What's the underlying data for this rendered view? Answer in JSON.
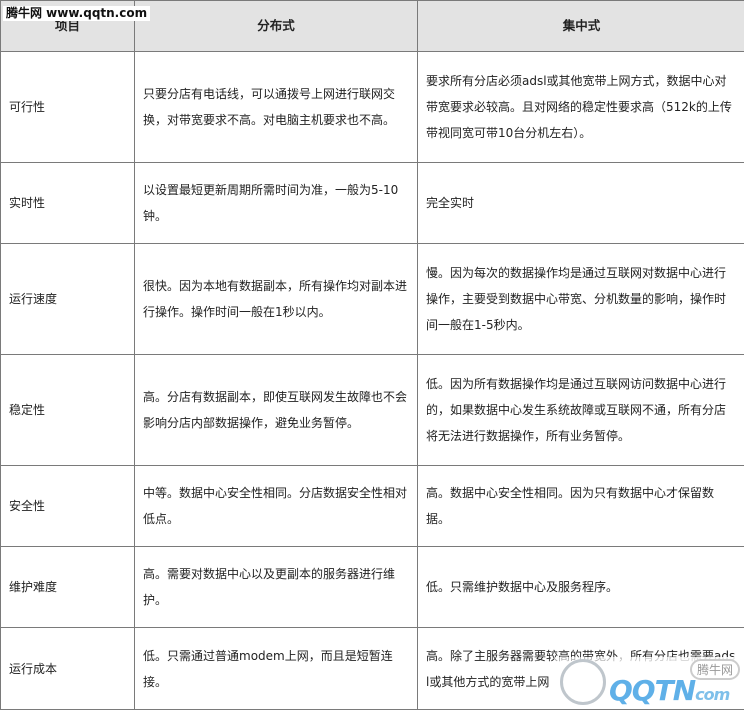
{
  "watermark": {
    "top": "腾牛网 www.qqtn.com",
    "logo_text": "QQTN",
    "logo_suffix": "com",
    "badge": "腾牛网"
  },
  "headers": [
    "项目",
    "分布式",
    "集中式"
  ],
  "rows": [
    {
      "item": "可行性",
      "distributed": "只要分店有电话线，可以通拨号上网进行联网交换，对带宽要求不高。对电脑主机要求也不高。",
      "centralized": "要求所有分店必须adsl或其他宽带上网方式，数据中心对带宽要求必较高。且对网络的稳定性要求高（512k的上传带视同宽可带10台分机左右）。"
    },
    {
      "item": "实时性",
      "distributed": "以设置最短更新周期所需时间为准，一般为5-10钟。",
      "centralized": "完全实时"
    },
    {
      "item": "运行速度",
      "distributed": "很快。因为本地有数据副本，所有操作均对副本进行操作。操作时间一般在1秒以内。",
      "centralized": "慢。因为每次的数据操作均是通过互联网对数据中心进行操作，主要受到数据中心带宽、分机数量的影响，操作时间一般在1-5秒内。"
    },
    {
      "item": "稳定性",
      "distributed": "高。分店有数据副本，即使互联网发生故障也不会影响分店内部数据操作，避免业务暂停。",
      "centralized": "低。因为所有数据操作均是通过互联网访问数据中心进行的，如果数据中心发生系统故障或互联网不通，所有分店将无法进行数据操作，所有业务暂停。"
    },
    {
      "item": "安全性",
      "distributed": "中等。数据中心安全性相同。分店数据安全性相对低点。",
      "centralized": "高。数据中心安全性相同。因为只有数据中心才保留数据。"
    },
    {
      "item": "维护难度",
      "distributed": "高。需要对数据中心以及更副本的服务器进行维护。",
      "centralized": "低。只需维护数据中心及服务程序。"
    },
    {
      "item": "运行成本",
      "distributed": "低。只需通过普通modem上网，而且是短暂连接。",
      "centralized": "高。除了主服务器需要较高的带宽外，所有分店也需要adsl或其他方式的宽带上网"
    }
  ]
}
